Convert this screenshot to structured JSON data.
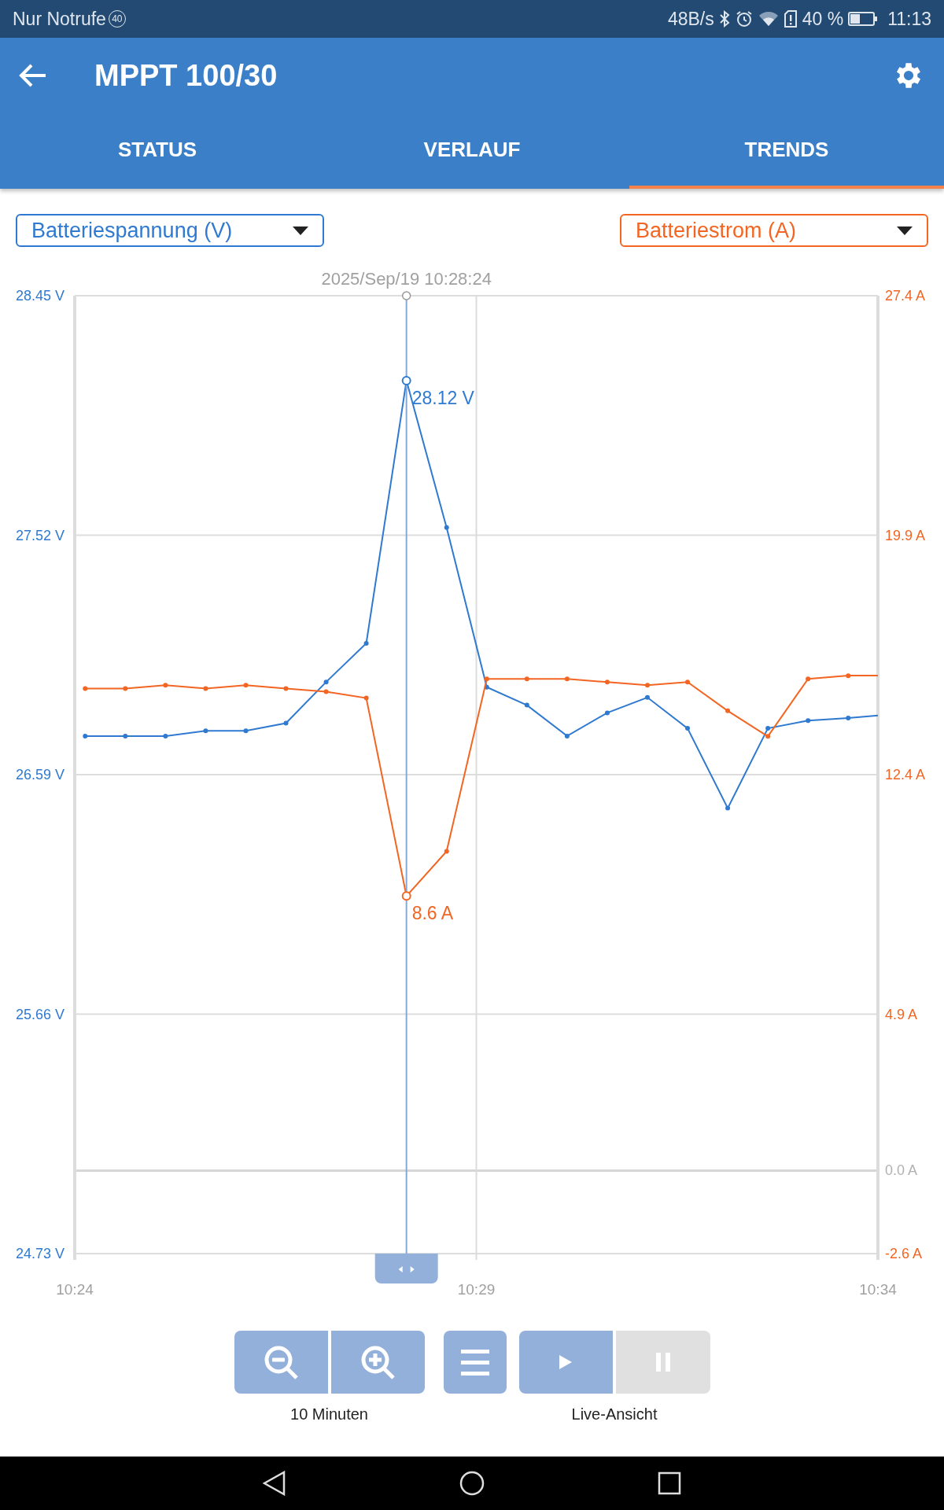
{
  "status_bar": {
    "carrier": "Nur Notrufe",
    "badge": "40",
    "speed": "48B/s",
    "battery": "40 %",
    "time": "11:13"
  },
  "app_bar": {
    "title": "MPPT 100/30"
  },
  "tabs": [
    {
      "label": "STATUS",
      "selected": false
    },
    {
      "label": "VERLAUF",
      "selected": false
    },
    {
      "label": "TRENDS",
      "selected": true
    }
  ],
  "chart": {
    "chart_data": {
      "type": "line",
      "grid": "y",
      "ref_lines": [
        {
          "axis": "x",
          "value": 629
        }
      ],
      "x": [
        624.13,
        624.63,
        625.13,
        625.63,
        626.13,
        626.63,
        627.13,
        627.63,
        628.13,
        628.63,
        629.13,
        629.63,
        630.13,
        630.63,
        631.13,
        631.63,
        632.13,
        632.63,
        633.13,
        633.63,
        634
      ],
      "xlim": [
        624,
        634
      ],
      "xticks": [
        {
          "value": 624,
          "label": "10:24"
        },
        {
          "value": 629,
          "label": "10:29"
        },
        {
          "value": 634,
          "label": "10:34"
        }
      ],
      "ylim": [
        24.73,
        28.45
      ],
      "yticks": [
        {
          "value": 24.73,
          "label": "24.73 V"
        },
        {
          "value": 25.66,
          "label": "25.66 V"
        },
        {
          "value": 26.59,
          "label": "26.59 V"
        },
        {
          "value": 27.52,
          "label": "27.52 V"
        },
        {
          "value": 28.45,
          "label": "28.45 V"
        }
      ],
      "y2lim": [
        -2.6,
        27.4
      ],
      "y2ticks": [
        {
          "value": -2.6,
          "label": "-2.6 A"
        },
        {
          "value": 0,
          "label": "0.0 A"
        },
        {
          "value": 4.9,
          "label": "4.9 A"
        },
        {
          "value": 12.4,
          "label": "12.4 A"
        },
        {
          "value": 19.9,
          "label": "19.9 A"
        },
        {
          "value": 27.4,
          "label": "27.4 A"
        }
      ],
      "series": [
        {
          "name": "Batteriespannung (V)",
          "color": "#2f7ad0",
          "marker": true,
          "values": [
            26.74,
            26.74,
            26.74,
            26.76,
            26.76,
            26.79,
            26.95,
            27.1,
            28.12,
            27.55,
            26.93,
            26.86,
            26.74,
            26.83,
            26.89,
            26.77,
            26.46,
            26.77,
            26.8,
            26.81,
            26.82
          ]
        },
        {
          "name": "Batteriestrom (A)",
          "color": "#f26522",
          "axis": "y2",
          "marker": true,
          "values": [
            15.1,
            15.1,
            15.2,
            15.1,
            15.2,
            15.1,
            15.0,
            14.8,
            8.6,
            10.0,
            15.4,
            15.4,
            15.4,
            15.3,
            15.2,
            15.3,
            14.4,
            13.6,
            15.4,
            15.5,
            15.5
          ]
        }
      ],
      "annotations": [
        {
          "x": 628.13,
          "text": "2025/Sep/19 10:28:24"
        },
        {
          "x": 628.13,
          "y": 28.12,
          "text": "28.12 V"
        },
        "8.6 A"
      ]
    }
  },
  "controls": {
    "buttons": [
      {
        "kind": "zoom-out",
        "disabled": false
      },
      {
        "kind": "zoom-in",
        "disabled": false
      },
      {
        "kind": "menu",
        "disabled": false
      },
      {
        "kind": "play",
        "disabled": false
      },
      {
        "kind": "pause",
        "disabled": true
      }
    ],
    "zoom_caption": "10 Minuten",
    "live_caption": "Live-Ansicht"
  }
}
